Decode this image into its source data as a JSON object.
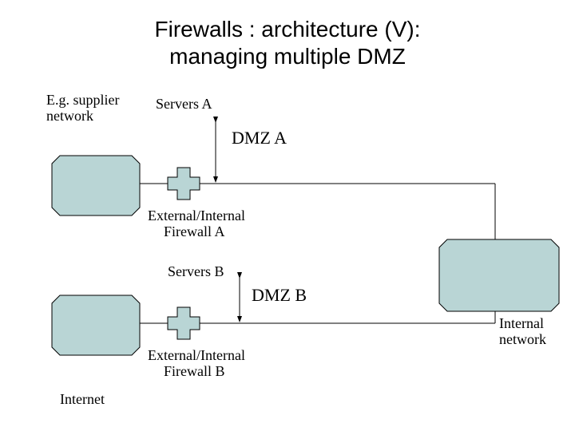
{
  "title_line1": "Firewalls : architecture (V):",
  "title_line2": "managing multiple DMZ",
  "labels": {
    "supplier1": "E.g. supplier",
    "supplier2": "network",
    "serversA": "Servers A",
    "dmzA": "DMZ A",
    "fwA1": "External/Internal",
    "fwA2": "Firewall A",
    "serversB": "Servers B",
    "dmzB": "DMZ B",
    "fwB1": "External/Internal",
    "fwB2": "Firewall B",
    "internet": "Internet",
    "internal1": "Internal",
    "internal2": "network"
  },
  "colors": {
    "fill": "#b9d5d5",
    "stroke": "#000000"
  }
}
